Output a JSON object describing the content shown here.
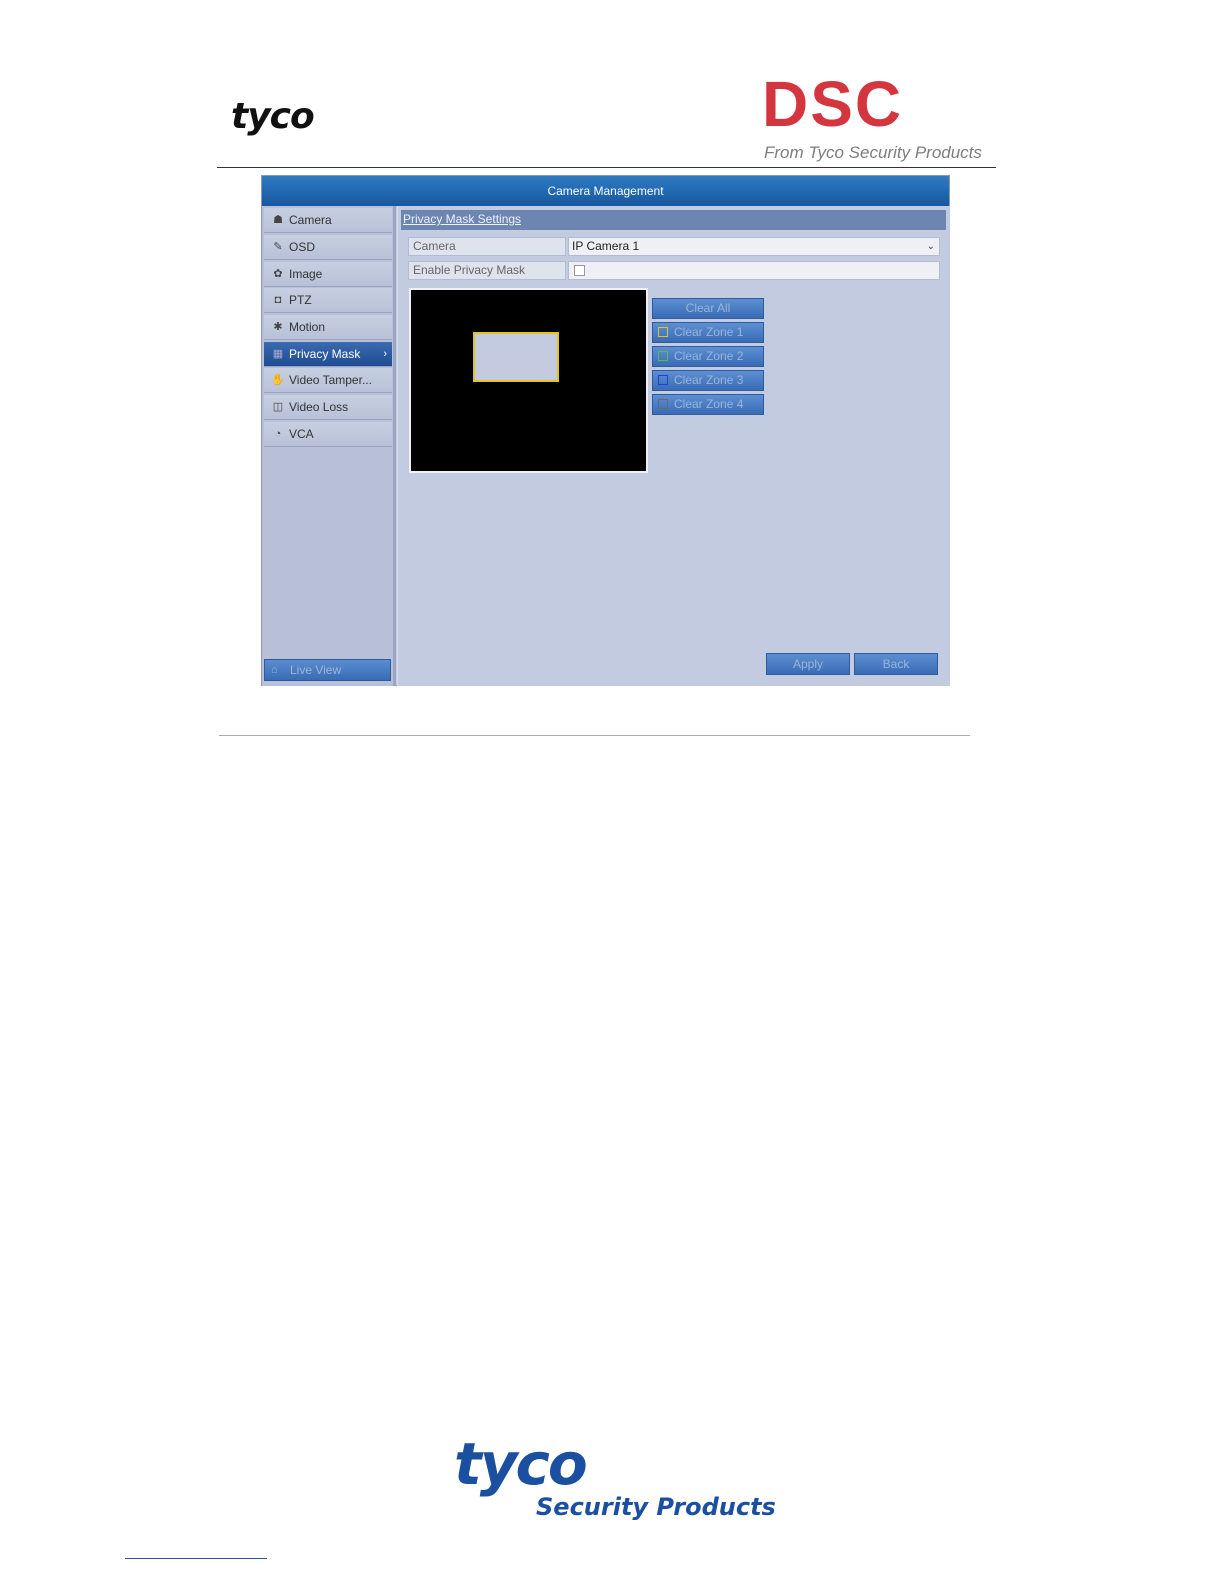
{
  "header": {
    "tyco_logo": "tyco",
    "dsc_logo": "DSC",
    "dsc_tagline": "From Tyco Security Products"
  },
  "window": {
    "title": "Camera Management",
    "sidebar": {
      "items": [
        {
          "label": "Camera",
          "icon": "camera-icon",
          "glyph": "☗"
        },
        {
          "label": "OSD",
          "icon": "osd-icon",
          "glyph": "✎"
        },
        {
          "label": "Image",
          "icon": "image-icon",
          "glyph": "✿"
        },
        {
          "label": "PTZ",
          "icon": "ptz-icon",
          "glyph": "◘"
        },
        {
          "label": "Motion",
          "icon": "motion-icon",
          "glyph": "✱"
        },
        {
          "label": "Privacy Mask",
          "icon": "privacy-mask-icon",
          "glyph": "▦",
          "active": true,
          "chevron": "›"
        },
        {
          "label": "Video Tamper...",
          "icon": "video-tamper-icon",
          "glyph": "✋"
        },
        {
          "label": "Video Loss",
          "icon": "video-loss-icon",
          "glyph": "◫"
        },
        {
          "label": "VCA",
          "icon": "vca-icon",
          "glyph": "◔"
        }
      ],
      "live_view": {
        "label": "Live View",
        "icon": "home-icon",
        "glyph": "⌂"
      }
    },
    "content": {
      "section_title": "Privacy Mask Settings",
      "camera_label": "Camera",
      "camera_value": "IP Camera 1",
      "enable_label": "Enable Privacy Mask",
      "enable_checked": false,
      "buttons": {
        "clear_all": "Clear All",
        "zones": [
          {
            "label": "Clear Zone 1",
            "color": "#e1c51a"
          },
          {
            "label": "Clear Zone 2",
            "color": "#5fb84a"
          },
          {
            "label": "Clear Zone 3",
            "color": "#1f3fd8"
          },
          {
            "label": "Clear Zone 4",
            "color": "#6a6a6a"
          }
        ],
        "apply": "Apply",
        "back": "Back"
      }
    }
  },
  "footer": {
    "tyco_logo": "tyco",
    "tyco_sub": "Security Products"
  },
  "colors": {
    "dsc_red": "#d4363f",
    "tyco_blue": "#1b4fa0",
    "titlebar_blue": "#17579f"
  }
}
